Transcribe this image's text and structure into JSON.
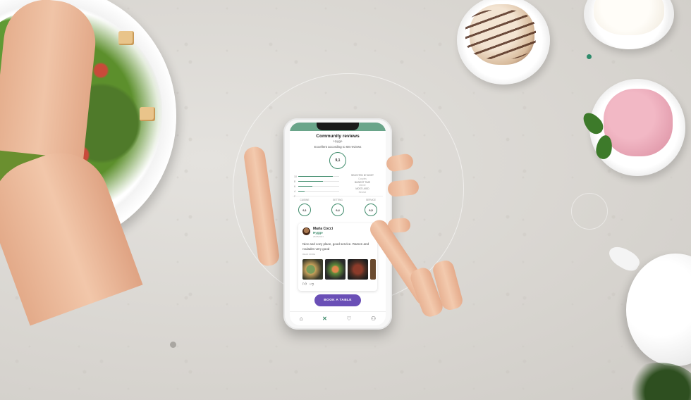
{
  "phone": {
    "status_time": "",
    "status_icons": "",
    "reviews": {
      "title": "Community reviews",
      "venue": "Hygge",
      "summary": "Excellent according to 68 reviews",
      "overall_score": "9,1",
      "rating_rows": [
        {
          "label": "10",
          "fill": 0.85
        },
        {
          "label": "8",
          "fill": 0.6
        },
        {
          "label": "6",
          "fill": 0.35
        },
        {
          "label": "4",
          "fill": 0.15
        },
        {
          "label": "2",
          "fill": 0.05
        }
      ],
      "meta": [
        {
          "text": "SELECTED BY MOST",
          "sm": false
        },
        {
          "text": "Couples",
          "sm": true
        },
        {
          "text": "BUSIEST TIME",
          "sm": false
        },
        {
          "text": "Dinner",
          "sm": true
        },
        {
          "text": "MOST LIKED",
          "sm": false
        },
        {
          "text": "Service",
          "sm": true
        }
      ],
      "categories": [
        {
          "label": "CUISINE",
          "score": "9,1"
        },
        {
          "label": "SETTING",
          "score": "9,4"
        },
        {
          "label": "SERVICE",
          "score": "9,5"
        }
      ]
    },
    "review_card": {
      "reviewer": "Maria Cocci",
      "venue": "Hygge",
      "date": "26/05/2021",
      "text": "Nice and cozy place, good service. Ramen and roulades very good",
      "read_more": "READ MORE",
      "like_icon": "thumbs-up-icon",
      "dislike_icon": "thumbs-down-icon"
    },
    "book_button": "BOOK A TABLE",
    "tabs": [
      {
        "icon": "home-icon",
        "glyph": "⌂",
        "active": false
      },
      {
        "icon": "cutlery-icon",
        "glyph": "✕",
        "active": true
      },
      {
        "icon": "heart-icon",
        "glyph": "♡",
        "active": false
      },
      {
        "icon": "profile-icon",
        "glyph": "⚇",
        "active": false
      }
    ]
  },
  "colors": {
    "accent_green": "#3e8b6b",
    "header_green": "#6aa58a",
    "button_purple": "#6a4fb6"
  }
}
